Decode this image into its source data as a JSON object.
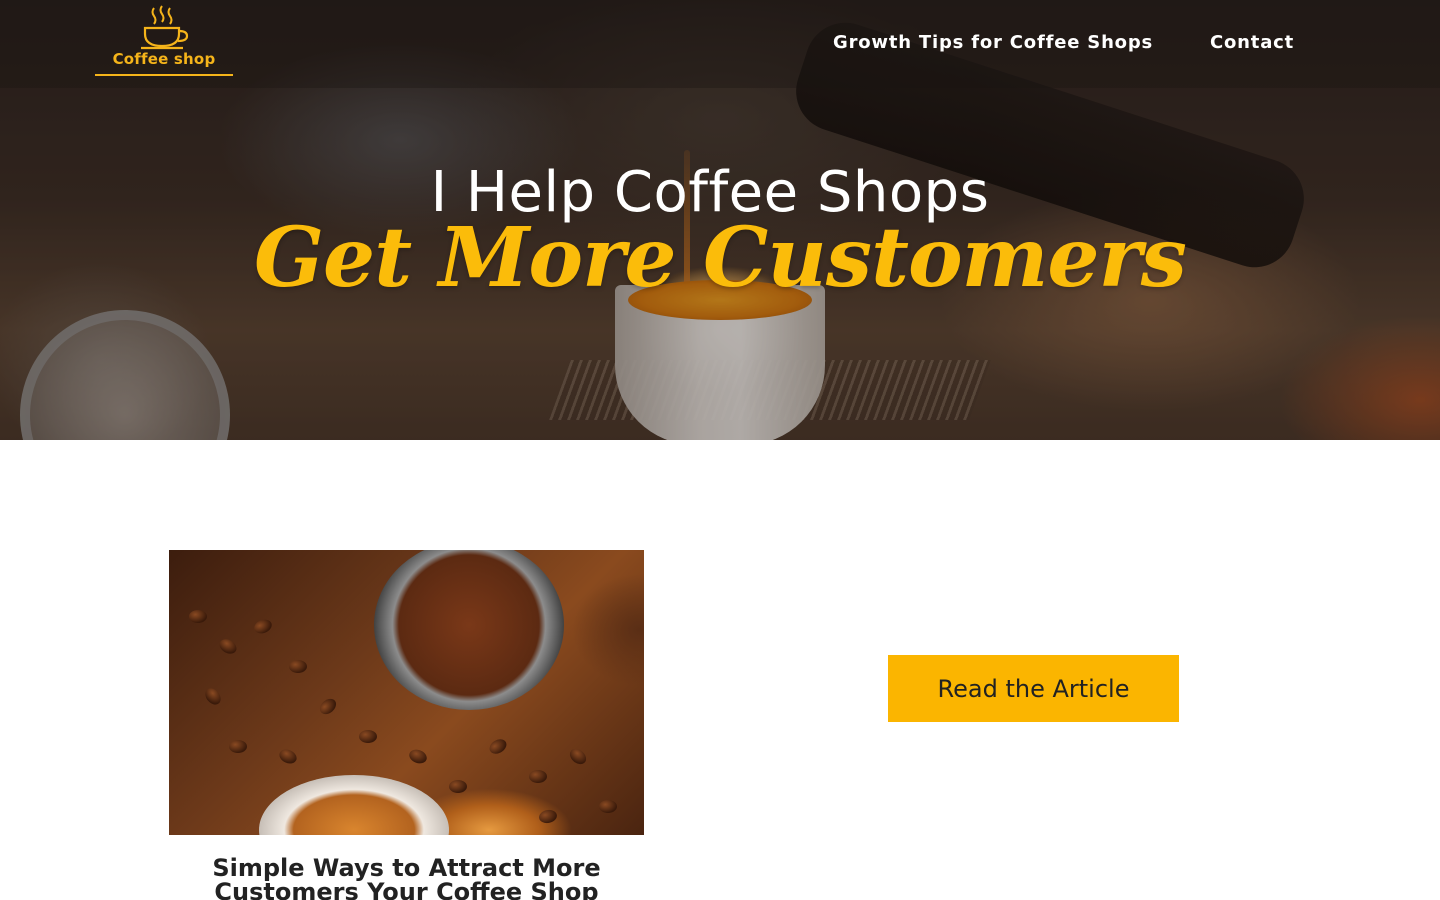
{
  "brand": {
    "logo_text": "Coffee shop",
    "logo_icon": "coffee-cup-icon",
    "accent_color": "#f5b41a"
  },
  "nav": {
    "items": [
      {
        "label": "Growth Tips for Coffee Shops"
      },
      {
        "label": "Contact"
      }
    ]
  },
  "hero": {
    "title": "I Help Coffee Shops",
    "subtitle": "Get More Customers",
    "subtitle_color": "#fbbc0a"
  },
  "article": {
    "title": "Simple Ways to Attract More Customers Your Coffee Shop",
    "button_label": "Read the Article",
    "button_color": "#fbb500"
  }
}
